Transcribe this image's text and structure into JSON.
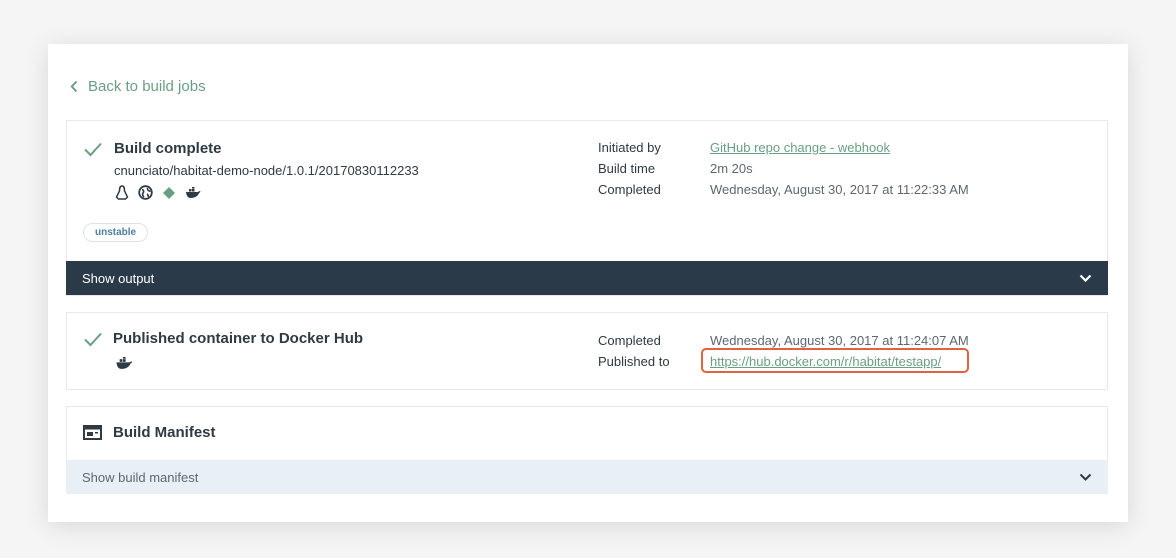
{
  "nav": {
    "back_label": "Back to build jobs"
  },
  "build": {
    "title": "Build complete",
    "package": "cnunciato/habitat-demo-node/1.0.1/20170830112233",
    "icons": [
      "linux-icon",
      "globe-icon",
      "diamond-icon",
      "docker-icon"
    ],
    "badge": "unstable",
    "meta": {
      "initiated_label": "Initiated by",
      "initiated_value": "GitHub repo change - webhook",
      "time_label": "Build time",
      "time_value": "2m 20s",
      "completed_label": "Completed",
      "completed_value": "Wednesday, August 30, 2017 at 11:22:33 AM"
    },
    "output_label": "Show output"
  },
  "publish": {
    "title": "Published container to Docker Hub",
    "icon": "docker-icon",
    "completed_label": "Completed",
    "completed_value": "Wednesday, August 30, 2017 at 11:24:07 AM",
    "published_label": "Published to",
    "published_value": "https://hub.docker.com/r/habitat/testapp/"
  },
  "manifest": {
    "title": "Build Manifest",
    "icon": "manifest-icon",
    "toggle_label": "Show build manifest"
  },
  "colors": {
    "accent_green": "#6a9f83",
    "dark_bar": "#2b3a48",
    "light_bar": "#e8eff5",
    "highlight": "#e0623e",
    "badge_text": "#4b7fa3"
  }
}
